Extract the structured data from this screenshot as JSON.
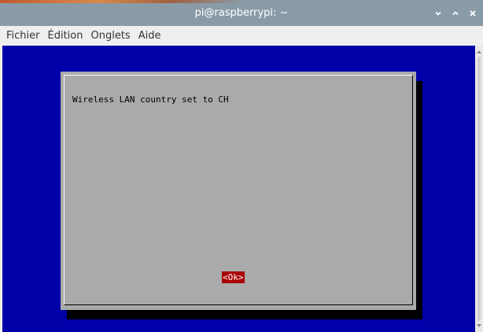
{
  "window": {
    "title": "pi@raspberrypi: ~"
  },
  "menubar": {
    "items": [
      "Fichier",
      "Édition",
      "Onglets",
      "Aide"
    ]
  },
  "dialog": {
    "message": "Wireless LAN country set to CH",
    "ok_label": "<Ok>"
  },
  "colors": {
    "terminal_bg": "#0000a8",
    "dialog_bg": "#aaaaaa",
    "button_active_bg": "#a80000",
    "titlebar_bg": "#8a9ba8"
  },
  "icons": {
    "minimize": "chevron-down-icon",
    "maximize": "chevron-up-icon",
    "close": "close-icon"
  }
}
